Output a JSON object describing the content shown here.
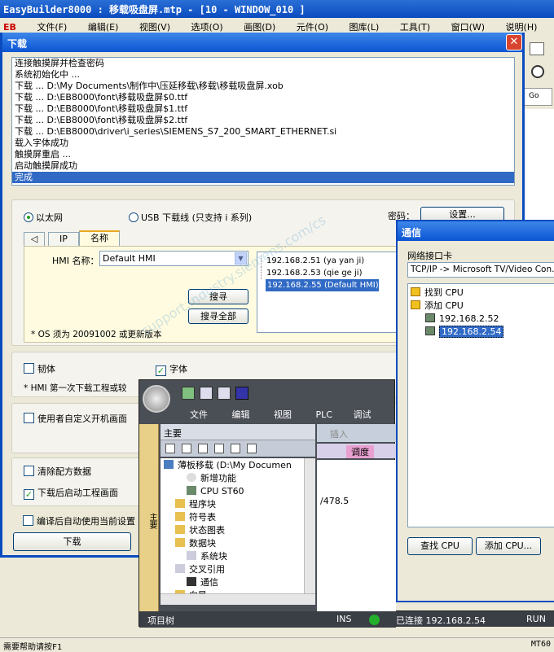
{
  "app": {
    "title": "EasyBuilder8000 : 移载吸盘屏.mtp - [10 - WINDOW_010 ]",
    "logo": "EB",
    "menu": [
      "文件(F)",
      "编辑(E)",
      "视图(V)",
      "选项(O)",
      "画图(D)",
      "元件(O)",
      "图库(L)",
      "工具(T)",
      "窗口(W)",
      "说明(H)"
    ],
    "right_text": "Go"
  },
  "download": {
    "title": "下载",
    "close": "✕",
    "log": [
      "连接触摸屏并检查密码",
      "系统初始化中 ...",
      "下载 ... D:\\My Documents\\制作中\\压延移载\\移载\\移载吸盘屏.xob",
      "下载 ... D:\\EB8000\\font\\移载吸盘屏$0.ttf",
      "下载 ... D:\\EB8000\\font\\移载吸盘屏$1.ttf",
      "下载 ... D:\\EB8000\\font\\移载吸盘屏$2.ttf",
      "下载 ... D:\\EB8000\\driver\\i_series\\SIEMENS_S7_200_SMART_ETHERNET.si",
      "载入字体成功",
      "触摸屏重启 ...",
      "启动触摸屏成功",
      "完成"
    ],
    "radio_ethernet": "以太网",
    "radio_usb": "USB 下载线 (只支持 i 系列)",
    "password_label": "密码：",
    "settings_button": "设置...",
    "tab_arrow": "◁",
    "tab_ip": "IP",
    "tab_name": "名称",
    "hmi_name_label": "HMI 名称：",
    "hmi_name_value": "Default HMI",
    "search_button": "搜寻",
    "search_all_button": "搜寻全部",
    "os_note": "* OS 须为 20091002 或更新版本",
    "ip_list": [
      "192.168.2.51 (ya yan ji)",
      "192.168.2.53 (qie ge ji)",
      "192.168.2.55 (Default HMI)"
    ],
    "firmware": "韧体",
    "font": "字体",
    "first_note": "* HMI 第一次下载工程或较",
    "custom_boot": "使用者自定义开机画面",
    "clear_recipe": "清除配方数据",
    "start_after": "下载后启动工程画面",
    "auto_use": "编译后自动使用当前设置",
    "download_button": "下载"
  },
  "comm": {
    "title": "通信",
    "net_card_label": "网络接口卡",
    "net_card_value": "TCP/IP -> Microsoft TV/Video Con...",
    "tree": [
      "找到 CPU",
      "添加 CPU",
      "192.168.2.52",
      "192.168.2.54"
    ],
    "find_cpu_button": "查找 CPU",
    "add_cpu_button": "添加 CPU..."
  },
  "step7": {
    "menu": [
      "文件",
      "编辑",
      "视图",
      "PLC",
      "调试"
    ],
    "pane_title": "主要",
    "side_tab": "项目树",
    "tree": [
      "薄板移载 (D:\\My Documen",
      "新增功能",
      "CPU ST60",
      "程序块",
      "符号表",
      "状态图表",
      "数据块",
      "系统块",
      "交叉引用",
      "通信",
      "向导"
    ],
    "insert": "插入",
    "tab_debug": "调度",
    "editor_value": "/478.5",
    "status": {
      "tree": "项目树",
      "ins": "INS",
      "connected": "已连接 192.168.2.54",
      "run": "RUN"
    }
  },
  "watermark": "support.industry.siemens.com/cs",
  "status_bar": {
    "help": "需要帮助请按F1",
    "right": "MT60"
  }
}
